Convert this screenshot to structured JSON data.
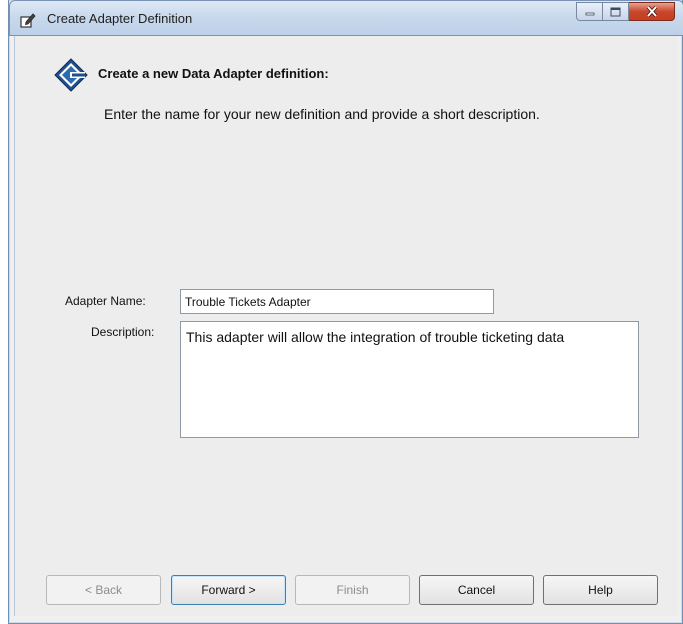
{
  "window": {
    "title": "Create Adapter Definition",
    "controls": {
      "minimize": "minimize-icon",
      "maximize": "maximize-icon",
      "close": "close-icon"
    }
  },
  "header": {
    "icon": "adapter-logo-icon",
    "title": "Create a new Data Adapter definition:",
    "subtitle": "Enter the name for your new definition and provide a short description."
  },
  "form": {
    "adapter_name": {
      "label": "Adapter Name:",
      "value": "Trouble Tickets Adapter"
    },
    "description": {
      "label": "Description:",
      "value": "This adapter will allow the integration of trouble ticketing data"
    }
  },
  "buttons": {
    "back": "< Back",
    "forward": "Forward >",
    "finish": "Finish",
    "cancel": "Cancel",
    "help": "Help"
  },
  "colors": {
    "titlebar": "#c9d9ec",
    "close": "#c9472d",
    "background": "#ededed"
  }
}
